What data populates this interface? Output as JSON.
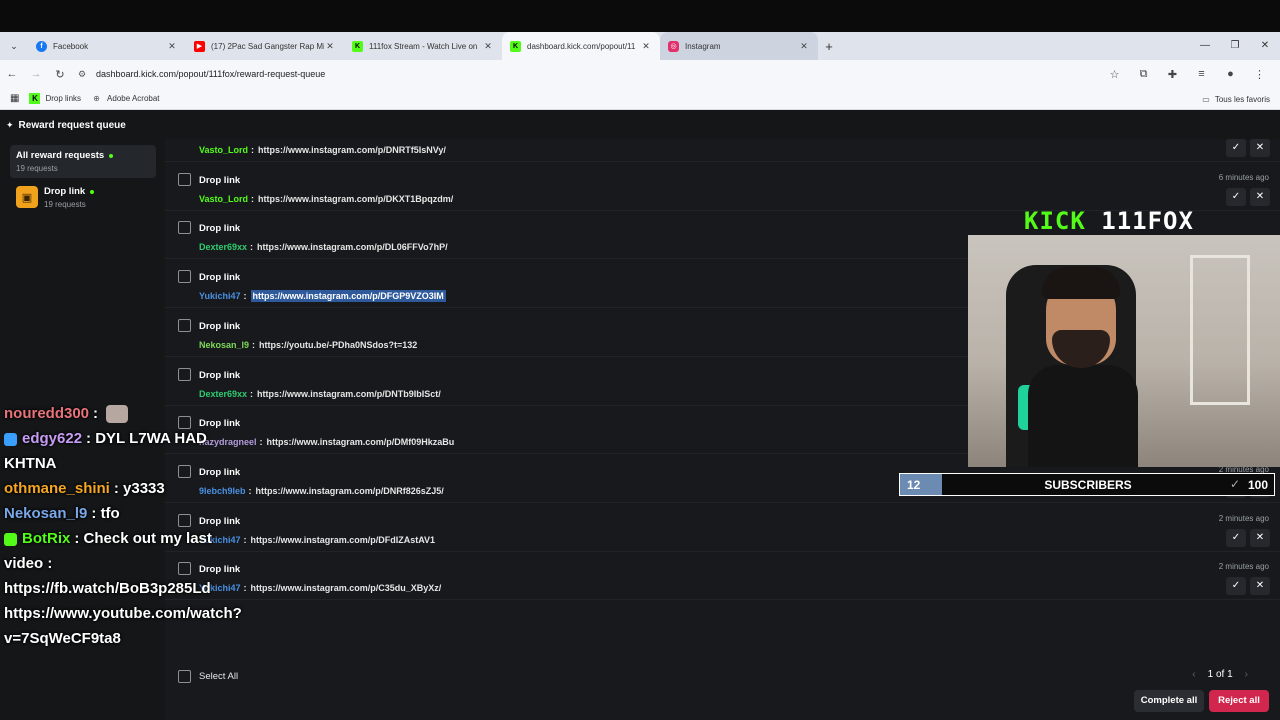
{
  "browser": {
    "tabs": [
      {
        "title": "Facebook",
        "color": "#1877f2",
        "icon": "facebook-icon"
      },
      {
        "title": "(17) 2Pac Sad Gangster Rap Mi",
        "color": "#ff0000",
        "icon": "youtube-icon"
      },
      {
        "title": "111fox Stream - Watch Live on",
        "color": "#53fc18",
        "icon": "kick-icon"
      },
      {
        "title": "dashboard.kick.com/popout/11",
        "color": "#53fc18",
        "icon": "kick-icon"
      },
      {
        "title": "Instagram",
        "color": "#e1306c",
        "icon": "instagram-icon"
      }
    ],
    "url": "dashboard.kick.com/popout/111fox/reward-request-queue",
    "bookmarks": [
      {
        "label": "Drop links"
      },
      {
        "label": "Adobe Acrobat"
      }
    ],
    "bookmarks_right": "Tous les favoris"
  },
  "app": {
    "header_title": "Reward request queue",
    "sidebar": [
      {
        "name": "All reward requests",
        "count": "19 requests"
      },
      {
        "name": "Drop link",
        "count": "19 requests"
      }
    ],
    "rows": [
      {
        "title": "Drop link",
        "user": "Vasto_Lord",
        "user_color": "#53fc18",
        "link": "https://www.instagram.com/p/DNRTf5IsNVy/",
        "time": "6 minutes ago",
        "hl": false
      },
      {
        "title": "Drop link",
        "user": "Vasto_Lord",
        "user_color": "#53fc18",
        "link": "https://www.instagram.com/p/DKXT1Bpqzdm/",
        "time": "6 minutes ago",
        "hl": false
      },
      {
        "title": "Drop link",
        "user": "Dexter69xx",
        "user_color": "#2ecc71",
        "link": "https://www.instagram.com/p/DL06FFVo7hP/",
        "time": "",
        "hl": false
      },
      {
        "title": "Drop link",
        "user": "Yukichi47",
        "user_color": "#4a90e2",
        "link": "https://www.instagram.com/p/DFGP9VZO3IM",
        "time": "",
        "hl": true
      },
      {
        "title": "Drop link",
        "user": "Nekosan_l9",
        "user_color": "#7ed957",
        "link": "https://youtu.be/-PDha0NSdos?t=132",
        "time": "",
        "hl": false
      },
      {
        "title": "Drop link",
        "user": "Dexter69xx",
        "user_color": "#2ecc71",
        "link": "https://www.instagram.com/p/DNTb9IbISct/",
        "time": "",
        "hl": false
      },
      {
        "title": "Drop link",
        "user": "hazydragneel",
        "user_color": "#b39ddb",
        "link": "https://www.instagram.com/p/DMf09HkzaBu",
        "time": "",
        "hl": false
      },
      {
        "title": "Drop link",
        "user": "9lebch9leb",
        "user_color": "#4a90e2",
        "link": "https://www.instagram.com/p/DNRf826sZJ5/",
        "time": "2 minutes ago",
        "hl": false
      },
      {
        "title": "Drop link",
        "user": "Yukichi47",
        "user_color": "#4a90e2",
        "link": "https://www.instagram.com/p/DFdIZAstAV1",
        "time": "2 minutes ago",
        "hl": false
      },
      {
        "title": "Drop link",
        "user": "Yukichi47",
        "user_color": "#4a90e2",
        "link": "https://www.instagram.com/p/C35du_XByXz/",
        "time": "2 minutes ago",
        "hl": false
      }
    ],
    "select_all": "Select All",
    "pager": "1 of 1",
    "complete_all": "Complete all",
    "reject_all": "Reject all"
  },
  "chat": [
    {
      "user": "nouredd300",
      "color": "#e8737a",
      "text": "",
      "cat": true
    },
    {
      "user": "edgy622",
      "color": "#c79cf5",
      "text": "DYL L7WA HAD",
      "badge": "#3aa0ff"
    },
    {
      "user": "",
      "color": "#fff",
      "text": "KHTNA"
    },
    {
      "user": "othmane_shini",
      "color": "#f5a623",
      "text": "y3333"
    },
    {
      "user": "Nekosan_l9",
      "color": "#7aa7e8",
      "text": "tfo"
    },
    {
      "user": "BotRix",
      "color": "#53fc18",
      "text": "Check out my last",
      "badge": "#53fc18"
    },
    {
      "user": "",
      "color": "#fff",
      "text": "video :"
    },
    {
      "user": "",
      "color": "#fff",
      "text": "https://fb.watch/BoB3p285Ld"
    },
    {
      "user": "",
      "color": "#fff",
      "text": "https://www.youtube.com/watch?"
    },
    {
      "user": "",
      "color": "#fff",
      "text": "v=7SqWeCF9ta8"
    }
  ],
  "stream": {
    "logo_kick": "KICK",
    "logo_name": "111FOX",
    "sub_current": "12",
    "sub_label": "SUBSCRIBERS",
    "sub_goal": "100",
    "sub_progress": 0.12
  }
}
